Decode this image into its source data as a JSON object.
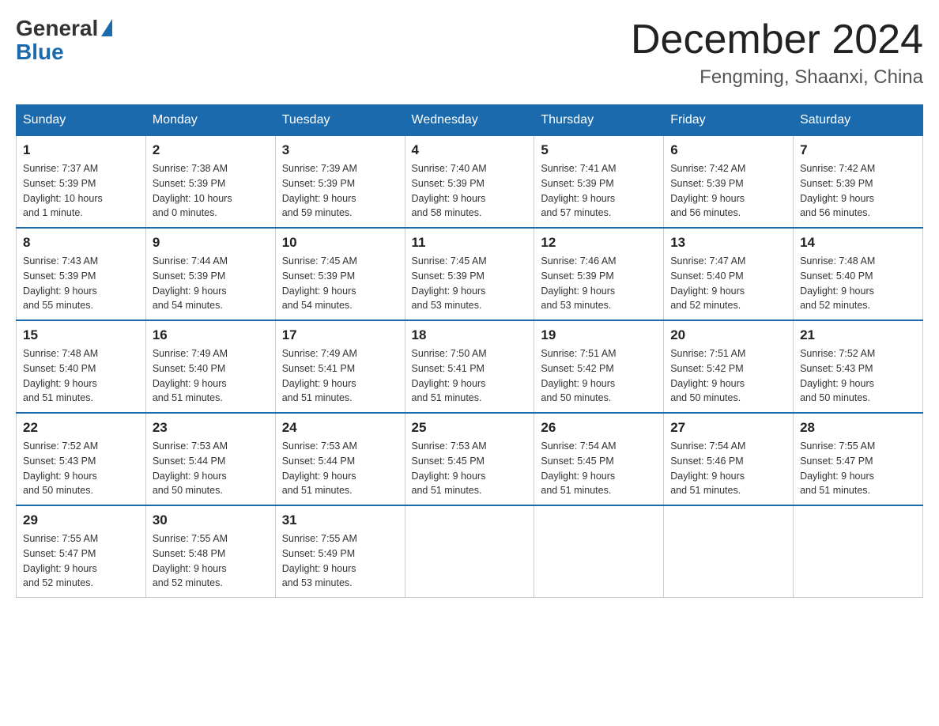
{
  "header": {
    "logo_general": "General",
    "logo_blue": "Blue",
    "month_title": "December 2024",
    "location": "Fengming, Shaanxi, China"
  },
  "weekdays": [
    "Sunday",
    "Monday",
    "Tuesday",
    "Wednesday",
    "Thursday",
    "Friday",
    "Saturday"
  ],
  "weeks": [
    [
      {
        "day": "1",
        "sunrise": "7:37 AM",
        "sunset": "5:39 PM",
        "daylight": "10 hours and 1 minute."
      },
      {
        "day": "2",
        "sunrise": "7:38 AM",
        "sunset": "5:39 PM",
        "daylight": "10 hours and 0 minutes."
      },
      {
        "day": "3",
        "sunrise": "7:39 AM",
        "sunset": "5:39 PM",
        "daylight": "9 hours and 59 minutes."
      },
      {
        "day": "4",
        "sunrise": "7:40 AM",
        "sunset": "5:39 PM",
        "daylight": "9 hours and 58 minutes."
      },
      {
        "day": "5",
        "sunrise": "7:41 AM",
        "sunset": "5:39 PM",
        "daylight": "9 hours and 57 minutes."
      },
      {
        "day": "6",
        "sunrise": "7:42 AM",
        "sunset": "5:39 PM",
        "daylight": "9 hours and 56 minutes."
      },
      {
        "day": "7",
        "sunrise": "7:42 AM",
        "sunset": "5:39 PM",
        "daylight": "9 hours and 56 minutes."
      }
    ],
    [
      {
        "day": "8",
        "sunrise": "7:43 AM",
        "sunset": "5:39 PM",
        "daylight": "9 hours and 55 minutes."
      },
      {
        "day": "9",
        "sunrise": "7:44 AM",
        "sunset": "5:39 PM",
        "daylight": "9 hours and 54 minutes."
      },
      {
        "day": "10",
        "sunrise": "7:45 AM",
        "sunset": "5:39 PM",
        "daylight": "9 hours and 54 minutes."
      },
      {
        "day": "11",
        "sunrise": "7:45 AM",
        "sunset": "5:39 PM",
        "daylight": "9 hours and 53 minutes."
      },
      {
        "day": "12",
        "sunrise": "7:46 AM",
        "sunset": "5:39 PM",
        "daylight": "9 hours and 53 minutes."
      },
      {
        "day": "13",
        "sunrise": "7:47 AM",
        "sunset": "5:40 PM",
        "daylight": "9 hours and 52 minutes."
      },
      {
        "day": "14",
        "sunrise": "7:48 AM",
        "sunset": "5:40 PM",
        "daylight": "9 hours and 52 minutes."
      }
    ],
    [
      {
        "day": "15",
        "sunrise": "7:48 AM",
        "sunset": "5:40 PM",
        "daylight": "9 hours and 51 minutes."
      },
      {
        "day": "16",
        "sunrise": "7:49 AM",
        "sunset": "5:40 PM",
        "daylight": "9 hours and 51 minutes."
      },
      {
        "day": "17",
        "sunrise": "7:49 AM",
        "sunset": "5:41 PM",
        "daylight": "9 hours and 51 minutes."
      },
      {
        "day": "18",
        "sunrise": "7:50 AM",
        "sunset": "5:41 PM",
        "daylight": "9 hours and 51 minutes."
      },
      {
        "day": "19",
        "sunrise": "7:51 AM",
        "sunset": "5:42 PM",
        "daylight": "9 hours and 50 minutes."
      },
      {
        "day": "20",
        "sunrise": "7:51 AM",
        "sunset": "5:42 PM",
        "daylight": "9 hours and 50 minutes."
      },
      {
        "day": "21",
        "sunrise": "7:52 AM",
        "sunset": "5:43 PM",
        "daylight": "9 hours and 50 minutes."
      }
    ],
    [
      {
        "day": "22",
        "sunrise": "7:52 AM",
        "sunset": "5:43 PM",
        "daylight": "9 hours and 50 minutes."
      },
      {
        "day": "23",
        "sunrise": "7:53 AM",
        "sunset": "5:44 PM",
        "daylight": "9 hours and 50 minutes."
      },
      {
        "day": "24",
        "sunrise": "7:53 AM",
        "sunset": "5:44 PM",
        "daylight": "9 hours and 51 minutes."
      },
      {
        "day": "25",
        "sunrise": "7:53 AM",
        "sunset": "5:45 PM",
        "daylight": "9 hours and 51 minutes."
      },
      {
        "day": "26",
        "sunrise": "7:54 AM",
        "sunset": "5:45 PM",
        "daylight": "9 hours and 51 minutes."
      },
      {
        "day": "27",
        "sunrise": "7:54 AM",
        "sunset": "5:46 PM",
        "daylight": "9 hours and 51 minutes."
      },
      {
        "day": "28",
        "sunrise": "7:55 AM",
        "sunset": "5:47 PM",
        "daylight": "9 hours and 51 minutes."
      }
    ],
    [
      {
        "day": "29",
        "sunrise": "7:55 AM",
        "sunset": "5:47 PM",
        "daylight": "9 hours and 52 minutes."
      },
      {
        "day": "30",
        "sunrise": "7:55 AM",
        "sunset": "5:48 PM",
        "daylight": "9 hours and 52 minutes."
      },
      {
        "day": "31",
        "sunrise": "7:55 AM",
        "sunset": "5:49 PM",
        "daylight": "9 hours and 53 minutes."
      },
      null,
      null,
      null,
      null
    ]
  ]
}
